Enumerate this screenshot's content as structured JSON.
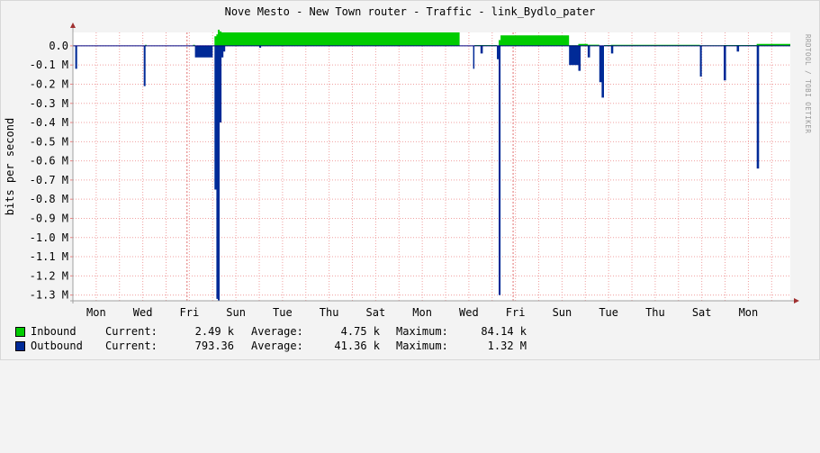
{
  "title": "Nove Mesto - New Town router - Traffic - link_Bydlo_pater",
  "watermark": "RRDTOOL / TOBI OETIKER",
  "chart_data": {
    "type": "area",
    "title": "Nove Mesto - New Town router - Traffic - link_Bydlo_pater",
    "ylabel": "bits per second",
    "ylim": [
      -1330000,
      70000
    ],
    "xlim": [
      0,
      15.4
    ],
    "y_ticks": [
      0,
      -100000,
      -200000,
      -300000,
      -400000,
      -500000,
      -600000,
      -700000,
      -800000,
      -900000,
      -1000000,
      -1100000,
      -1200000,
      -1300000
    ],
    "y_tick_labels": [
      "0.0",
      "-0.1 M",
      "-0.2 M",
      "-0.3 M",
      "-0.4 M",
      "-0.5 M",
      "-0.6 M",
      "-0.7 M",
      "-0.8 M",
      "-0.9 M",
      "-1.0 M",
      "-1.1 M",
      "-1.2 M",
      "-1.3 M"
    ],
    "x_tick_labels": [
      "Mon",
      "Wed",
      "Fri",
      "Sun",
      "Tue",
      "Thu",
      "Sat",
      "Mon",
      "Wed",
      "Fri",
      "Sun",
      "Tue",
      "Thu",
      "Sat",
      "Mon"
    ],
    "x_tick_positions": [
      0.5,
      1.5,
      2.5,
      3.5,
      4.5,
      5.5,
      6.5,
      7.5,
      8.5,
      9.5,
      10.5,
      11.5,
      12.5,
      13.5,
      14.5
    ],
    "grid": true,
    "legend_position": "bottom",
    "series": [
      {
        "name": "Inbound",
        "color": "#00cc00",
        "x": [
          0,
          1.45,
          1.5,
          1.55,
          1.58,
          2.55,
          2.58,
          2.62,
          3.0,
          3.04,
          3.08,
          3.11,
          3.15,
          3.19,
          8.3,
          8.62,
          9.1,
          9.14,
          9.18,
          10.65,
          10.85,
          11.05,
          11.3,
          11.4,
          11.55,
          13.46,
          13.97,
          14.68,
          15.4
        ],
        "values": [
          0,
          0,
          2000,
          5000,
          0,
          0,
          5000,
          0,
          0,
          50000,
          60000,
          84140,
          75000,
          70000,
          0,
          4000,
          0,
          30000,
          55000,
          3000,
          10000,
          6000,
          2000,
          4000,
          5000,
          3000,
          4000,
          10000,
          0
        ]
      },
      {
        "name": "Outbound",
        "color": "#002a97",
        "x": [
          0,
          0.05,
          0.09,
          1.45,
          1.52,
          1.56,
          2.58,
          2.62,
          3.0,
          3.04,
          3.08,
          3.11,
          3.15,
          3.19,
          3.23,
          3.27,
          4.0,
          4.04,
          8.55,
          8.59,
          8.62,
          8.75,
          8.8,
          9.1,
          9.14,
          9.18,
          10.55,
          10.65,
          10.85,
          10.9,
          11.05,
          11.1,
          11.3,
          11.35,
          11.4,
          11.55,
          11.6,
          13.46,
          13.5,
          13.97,
          14.02,
          14.25,
          14.3,
          14.68,
          14.73
        ],
        "values": [
          0,
          -120000,
          0,
          0,
          -210000,
          0,
          0,
          -60000,
          0,
          -750000,
          -1320000,
          -1330000,
          -400000,
          -60000,
          -30000,
          0,
          -10000,
          0,
          0,
          -120000,
          0,
          -40000,
          0,
          -70000,
          -1300000,
          0,
          0,
          -100000,
          -130000,
          0,
          -60000,
          0,
          -190000,
          -270000,
          0,
          -40000,
          0,
          -160000,
          0,
          -180000,
          0,
          -30000,
          0,
          -640000,
          0
        ]
      }
    ]
  },
  "legend": {
    "inbound": {
      "label": "Inbound",
      "current_label": "Current:",
      "current": "2.49 k",
      "average_label": "Average:",
      "average": "4.75 k",
      "maximum_label": "Maximum:",
      "maximum": "84.14 k",
      "color": "#00cc00"
    },
    "outbound": {
      "label": "Outbound",
      "current_label": "Current:",
      "current": "793.36",
      "average_label": "Average:",
      "average": "41.36 k",
      "maximum_label": "Maximum:",
      "maximum": "1.32 M",
      "color": "#002a97"
    }
  }
}
